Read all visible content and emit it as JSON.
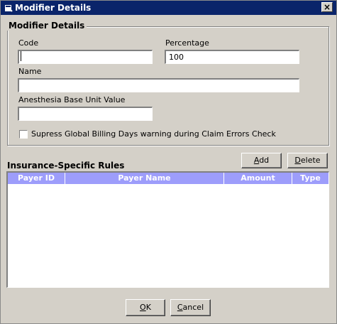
{
  "window": {
    "title": "Modifier Details",
    "close_glyph": "×",
    "title_icon": "app-icon"
  },
  "group": {
    "title": "Modifier Details"
  },
  "form": {
    "code_label": "Code",
    "code_value": "",
    "percentage_label": "Percentage",
    "percentage_value": "100",
    "name_label": "Name",
    "name_value": "",
    "anesthesia_label": "Anesthesia Base Unit Value",
    "anesthesia_value": "",
    "suppress_label": "Supress Global Billing Days warning during Claim Errors Check",
    "suppress_checked": false
  },
  "rules": {
    "title": "Insurance-Specific Rules",
    "add_label_prefix": "",
    "add_label_mnemonic": "A",
    "add_label_rest": "dd",
    "delete_label_prefix": "",
    "delete_label_mnemonic": "D",
    "delete_label_rest": "elete",
    "columns": [
      "Payer ID",
      "Payer Name",
      "Amount",
      "Type"
    ],
    "rows": []
  },
  "footer": {
    "ok_mnemonic": "O",
    "ok_rest": "K",
    "cancel_mnemonic": "C",
    "cancel_rest": "ancel"
  },
  "colors": {
    "titlebar": "#0a246a",
    "grid_header": "#9d9dfb",
    "face": "#d4d0c8"
  }
}
